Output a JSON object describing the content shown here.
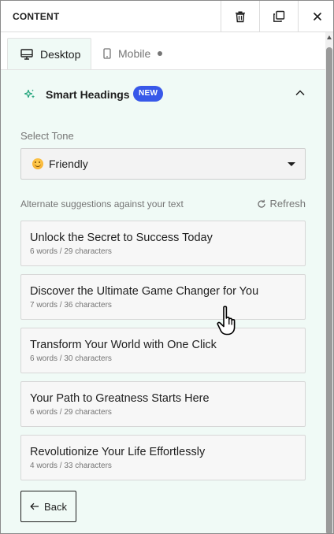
{
  "header": {
    "title": "CONTENT",
    "icons": [
      "trash-icon",
      "duplicate-icon",
      "close-icon"
    ]
  },
  "tabs": [
    {
      "label": "Desktop",
      "icon": "desktop-icon",
      "active": true
    },
    {
      "label": "Mobile",
      "icon": "mobile-icon",
      "active": false
    }
  ],
  "smart_headings": {
    "title": "Smart Headings",
    "badge": "NEW",
    "icon": "sparkle-icon",
    "accent_color": "#3858e9"
  },
  "tone": {
    "label": "Select Tone",
    "selected": "Friendly",
    "emoji": "smiley"
  },
  "suggestions": {
    "label": "Alternate suggestions against your text",
    "refresh_label": "Refresh",
    "items": [
      {
        "title": "Unlock the Secret to Success Today",
        "meta": "6 words / 29 characters"
      },
      {
        "title": "Discover the Ultimate Game Changer for You",
        "meta": "7 words / 36 characters"
      },
      {
        "title": "Transform Your World with One Click",
        "meta": "6 words / 30 characters"
      },
      {
        "title": "Your Path to Greatness Starts Here",
        "meta": "6 words / 29 characters"
      },
      {
        "title": "Revolutionize Your Life Effortlessly",
        "meta": "4 words / 33 characters"
      }
    ]
  },
  "back_label": "Back"
}
